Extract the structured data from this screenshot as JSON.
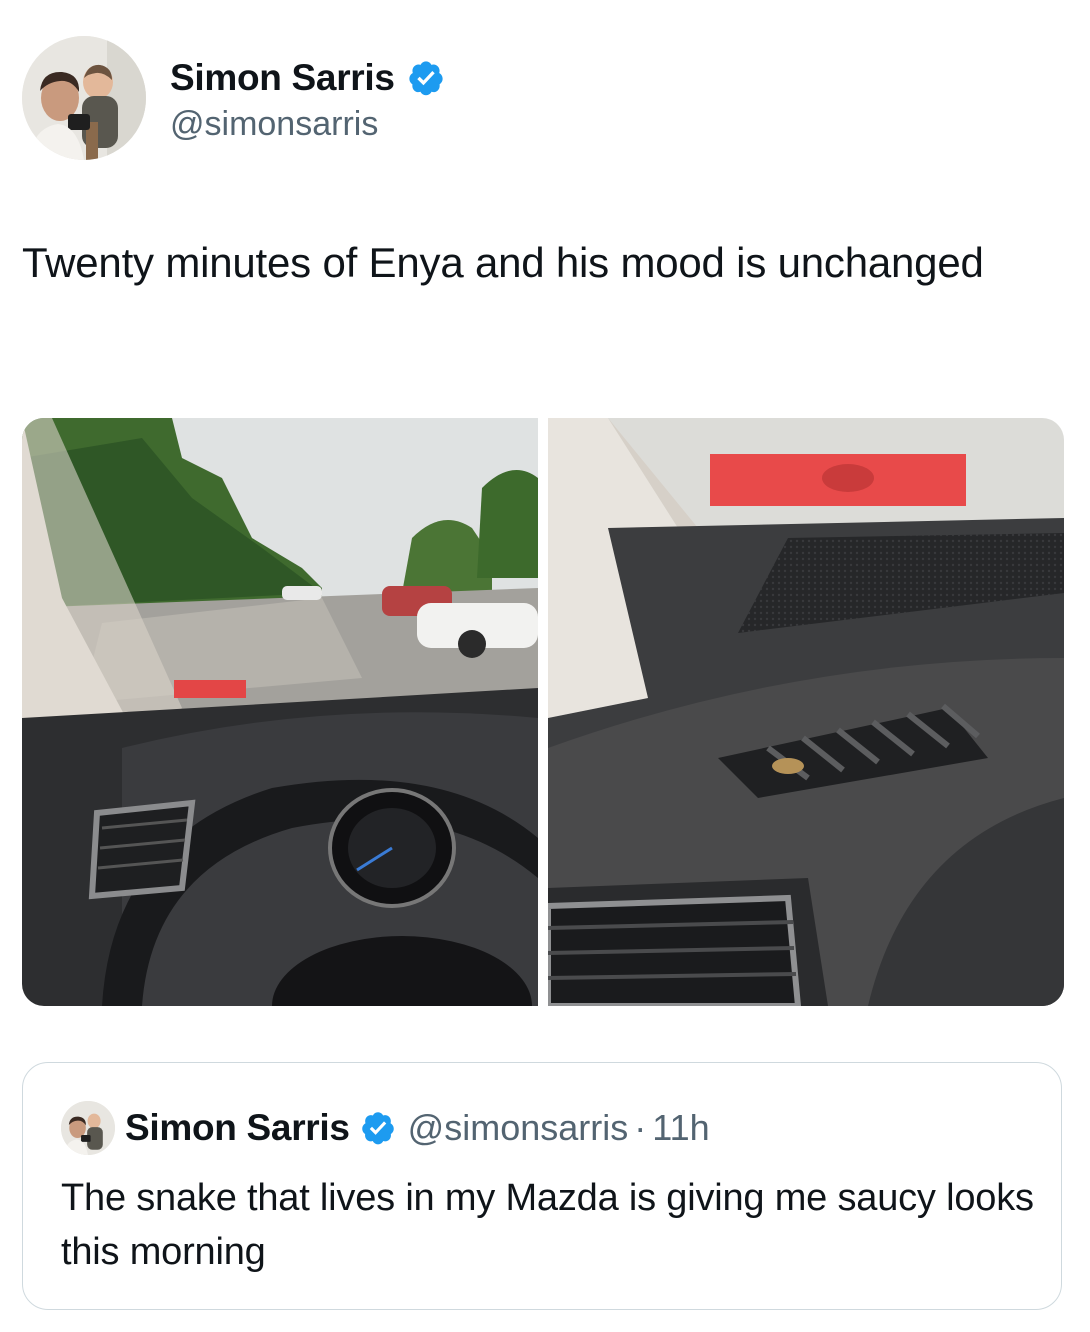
{
  "tweet": {
    "author": {
      "display_name": "Simon Sarris",
      "handle": "@simonsarris",
      "verified": true,
      "avatar_icon": "profile-photo"
    },
    "text": "Twenty minutes of Enya and his mood is unchanged",
    "media": [
      {
        "type": "photo",
        "description_icon": "car-interior-photo"
      },
      {
        "type": "photo",
        "description_icon": "dashboard-vent-photo"
      }
    ]
  },
  "quoted_tweet": {
    "author": {
      "display_name": "Simon Sarris",
      "handle": "@simonsarris",
      "verified": true
    },
    "separator": "·",
    "time": "11h",
    "text": "The snake that lives in my Mazda is giving me saucy looks this morning"
  },
  "colors": {
    "verified_blue": "#1d9bf0",
    "text": "#0f1419",
    "secondary_text": "#536471",
    "border": "#cfd9de"
  }
}
